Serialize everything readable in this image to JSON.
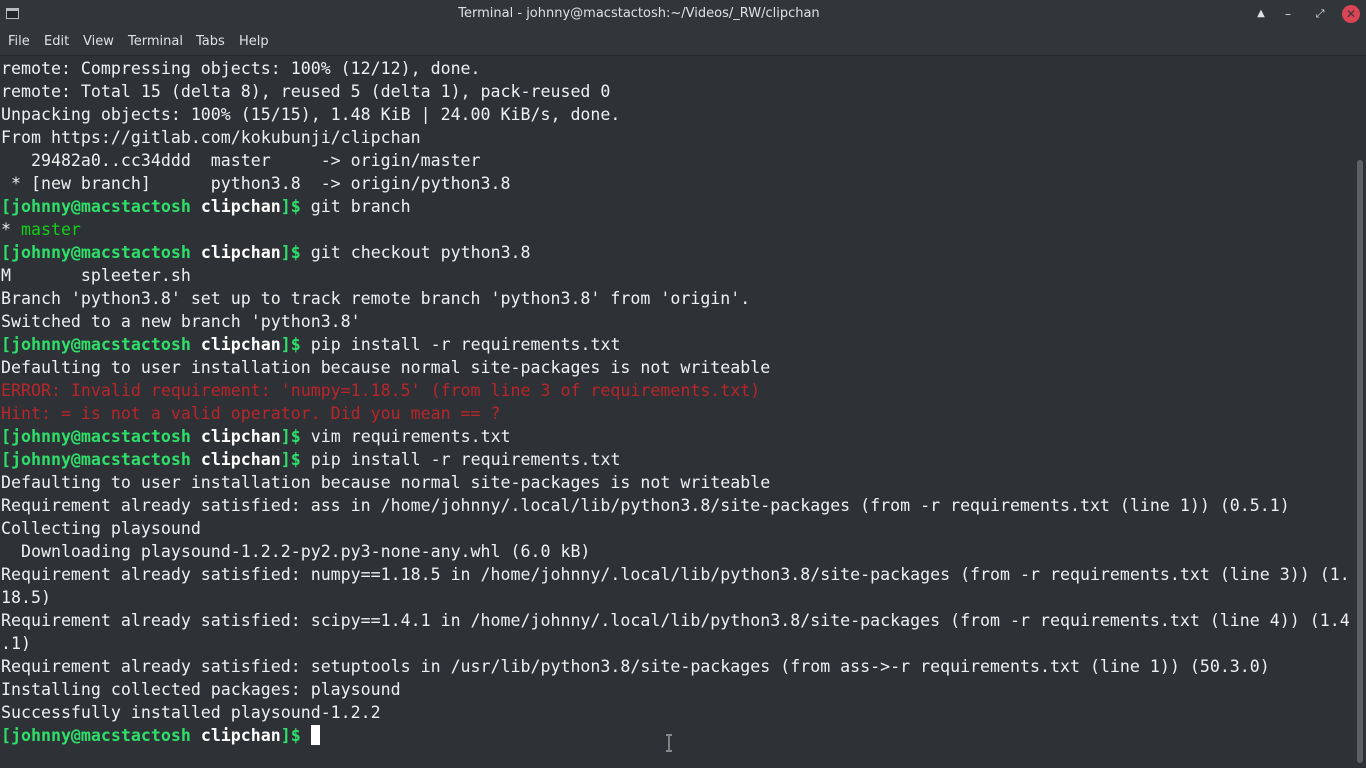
{
  "window": {
    "title": "Terminal - johnny@macstactosh:~/Videos/_RW/clipchan",
    "app_icon": "terminal-icon",
    "buttons": {
      "keep_above": "▲",
      "minimize": "–",
      "maximize": "⤢",
      "close": "✕"
    },
    "colors": {
      "close": "#da4453",
      "background": "#2e3136",
      "titlebar": "#31363b"
    }
  },
  "menubar": {
    "items": [
      "File",
      "Edit",
      "View",
      "Terminal",
      "Tabs",
      "Help"
    ]
  },
  "terminal": {
    "prompt": {
      "user_host": "[johnny@macstactosh",
      "dir": "clipchan",
      "close": "]$"
    },
    "colors": {
      "prompt": "#2ee06a",
      "error": "#b8262a",
      "text": "#eff0f1"
    },
    "lines": [
      {
        "text": "remote: Compressing objects: 100% (12/12), done."
      },
      {
        "text": "remote: Total 15 (delta 8), reused 5 (delta 1), pack-reused 0"
      },
      {
        "text": "Unpacking objects: 100% (15/15), 1.48 KiB | 24.00 KiB/s, done."
      },
      {
        "text": "From https://gitlab.com/kokubunji/clipchan"
      },
      {
        "text": "   29482a0..cc34ddd  master     -> origin/master"
      },
      {
        "text": " * [new branch]      python3.8  -> origin/python3.8"
      },
      {
        "cmd": "git branch"
      },
      {
        "star": "* ",
        "branch": "master"
      },
      {
        "cmd": "git checkout python3.8"
      },
      {
        "text": "M       spleeter.sh"
      },
      {
        "text": "Branch 'python3.8' set up to track remote branch 'python3.8' from 'origin'."
      },
      {
        "text": "Switched to a new branch 'python3.8'"
      },
      {
        "cmd": "pip install -r requirements.txt"
      },
      {
        "text": "Defaulting to user installation because normal site-packages is not writeable"
      },
      {
        "error": "ERROR: Invalid requirement: 'numpy=1.18.5' (from line 3 of requirements.txt)"
      },
      {
        "error": "Hint: = is not a valid operator. Did you mean == ?"
      },
      {
        "cmd": "vim requirements.txt"
      },
      {
        "cmd": "pip install -r requirements.txt"
      },
      {
        "text": "Defaulting to user installation because normal site-packages is not writeable"
      },
      {
        "text": "Requirement already satisfied: ass in /home/johnny/.local/lib/python3.8/site-packages (from -r requirements.txt (line 1)) (0.5.1)"
      },
      {
        "text": "Collecting playsound"
      },
      {
        "text": "  Downloading playsound-1.2.2-py2.py3-none-any.whl (6.0 kB)"
      },
      {
        "text": "Requirement already satisfied: numpy==1.18.5 in /home/johnny/.local/lib/python3.8/site-packages (from -r requirements.txt (line 3)) (1."
      },
      {
        "text": "18.5)"
      },
      {
        "text": "Requirement already satisfied: scipy==1.4.1 in /home/johnny/.local/lib/python3.8/site-packages (from -r requirements.txt (line 4)) (1.4"
      },
      {
        "text": ".1)"
      },
      {
        "text": "Requirement already satisfied: setuptools in /usr/lib/python3.8/site-packages (from ass->-r requirements.txt (line 1)) (50.3.0)"
      },
      {
        "text": "Installing collected packages: playsound"
      },
      {
        "text": "Successfully installed playsound-1.2.2"
      },
      {
        "cmd": "",
        "active": true
      }
    ]
  }
}
